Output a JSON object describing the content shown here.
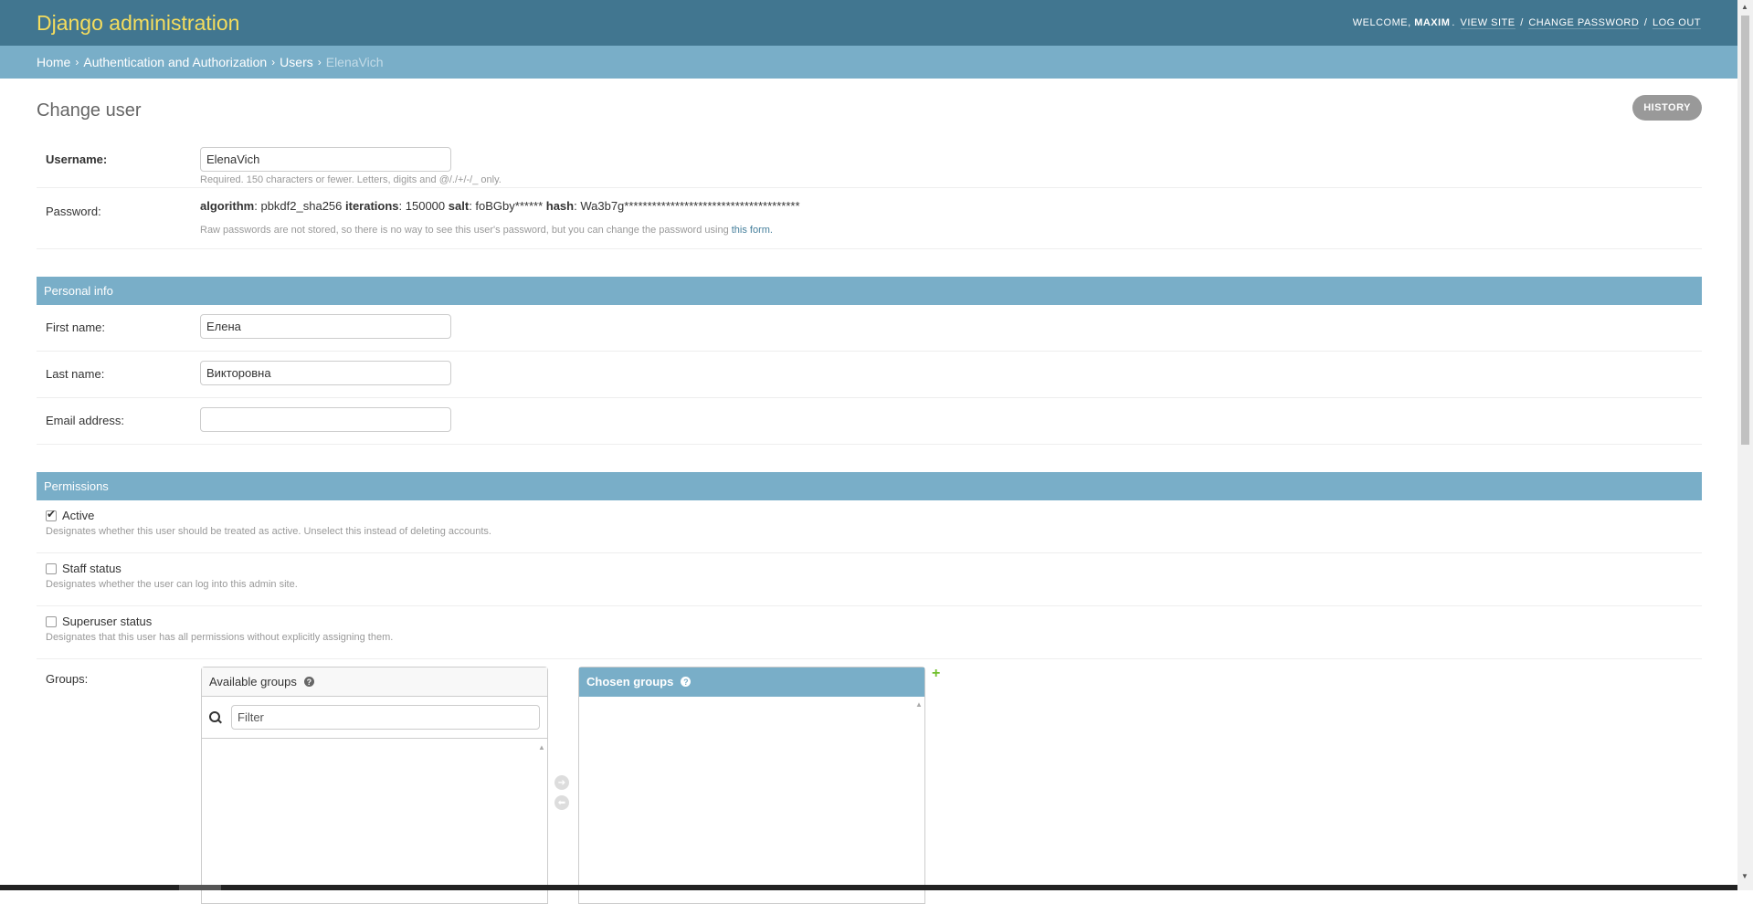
{
  "header": {
    "branding": "Django administration",
    "welcome": "Welcome,",
    "username": "MAXIM",
    "view_site": "View site",
    "change_password": "Change password",
    "log_out": "Log out"
  },
  "breadcrumbs": {
    "home": "Home",
    "app": "Authentication and Authorization",
    "model": "Users",
    "current": "ElenaVich",
    "separator": "›"
  },
  "page": {
    "title": "Change user",
    "history": "History"
  },
  "fields": {
    "username": {
      "label": "Username:",
      "value": "ElenaVich",
      "help": "Required. 150 characters or fewer. Letters, digits and @/./+/-/_ only."
    },
    "password": {
      "label": "Password:",
      "algorithm_label": "algorithm",
      "algorithm": "pbkdf2_sha256",
      "iterations_label": "iterations",
      "iterations": "150000",
      "salt_label": "salt",
      "salt": "foBGby******",
      "hash_label": "hash",
      "hash": "Wa3b7g**************************************",
      "help_prefix": "Raw passwords are not stored, so there is no way to see this user's password, but you can change the password using",
      "help_link": "this form."
    }
  },
  "personal_info": {
    "caption": "Personal info",
    "first_name": {
      "label": "First name:",
      "value": "Елена"
    },
    "last_name": {
      "label": "Last name:",
      "value": "Викторовна"
    },
    "email": {
      "label": "Email address:",
      "value": ""
    }
  },
  "permissions": {
    "caption": "Permissions",
    "active": {
      "label": "Active",
      "checked": true,
      "help": "Designates whether this user should be treated as active. Unselect this instead of deleting accounts."
    },
    "staff": {
      "label": "Staff status",
      "checked": false,
      "help": "Designates whether the user can log into this admin site."
    },
    "superuser": {
      "label": "Superuser status",
      "checked": false,
      "help": "Designates that this user has all permissions without explicitly assigning them."
    },
    "groups": {
      "label": "Groups:",
      "available_title": "Available groups",
      "chosen_title": "Chosen groups",
      "filter_placeholder": "Filter",
      "help_glyph": "?",
      "add_glyph": "+"
    }
  }
}
